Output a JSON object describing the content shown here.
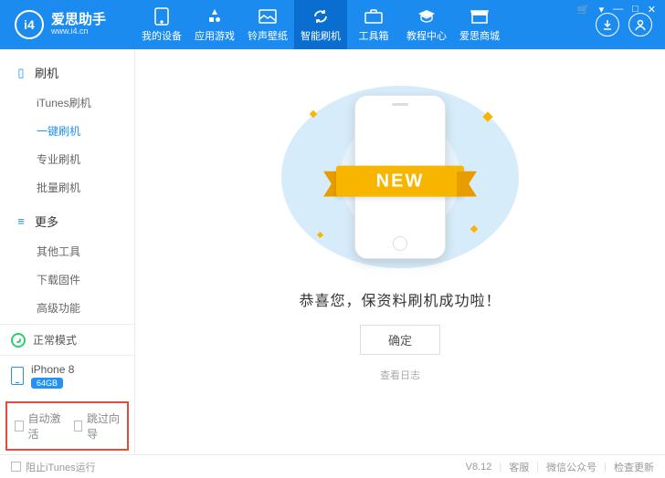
{
  "app": {
    "logo_initial": "i4",
    "logo_cn": "爱思助手",
    "logo_url": "www.i4.cn"
  },
  "nav": {
    "items": [
      {
        "label": "我的设备"
      },
      {
        "label": "应用游戏"
      },
      {
        "label": "铃声壁纸"
      },
      {
        "label": "智能刷机"
      },
      {
        "label": "工具箱"
      },
      {
        "label": "教程中心"
      },
      {
        "label": "爱思商城"
      }
    ],
    "active_index": 3
  },
  "titlebar": {
    "cart": "🛒",
    "tri": "▾",
    "min": "—",
    "max": "□",
    "close": "✕"
  },
  "sidebar": {
    "section_flash": "刷机",
    "flash_items": [
      "iTunes刷机",
      "一键刷机",
      "专业刷机",
      "批量刷机"
    ],
    "flash_active_index": 1,
    "section_more": "更多",
    "more_items": [
      "其他工具",
      "下载固件",
      "高级功能"
    ],
    "mode_label": "正常模式",
    "device_name": "iPhone 8",
    "device_storage": "64GB",
    "cb_auto_activate": "自动激活",
    "cb_skip_guide": "跳过向导"
  },
  "main": {
    "ribbon_text": "NEW",
    "success_text": "恭喜您，保资料刷机成功啦！",
    "ok_label": "确定",
    "log_label": "查看日志"
  },
  "footer": {
    "block_itunes": "阻止iTunes运行",
    "version": "V8.12",
    "support": "客服",
    "wechat": "微信公众号",
    "update": "检查更新"
  }
}
